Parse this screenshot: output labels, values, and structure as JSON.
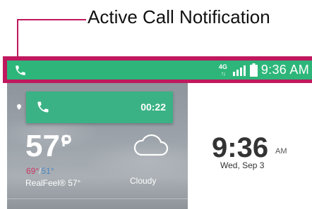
{
  "annotation": {
    "label": "Active Call Notification",
    "accent_color": "#c0185e"
  },
  "status_bar": {
    "background_color": "#2eb67a",
    "left_icon": "phone-icon",
    "network": "4G",
    "signal_icon": "signal-icon",
    "battery_icon": "battery-icon",
    "time": "9:36 AM"
  },
  "call_notification": {
    "icon": "phone-icon",
    "timer": "00:22",
    "color": "#3bb285"
  },
  "weather_widget": {
    "temperature": "57°",
    "unit": "F",
    "high": "69°",
    "separator": "/",
    "low": "51°",
    "realfeel": "RealFeel® 57°",
    "condition": "Cloudy",
    "condition_icon": "cloud-icon",
    "high_color": "#c93763",
    "low_color": "#4b88c2"
  },
  "clock_widget": {
    "time": "9:36",
    "ampm": "AM",
    "date": "Wed, Sep 3"
  }
}
